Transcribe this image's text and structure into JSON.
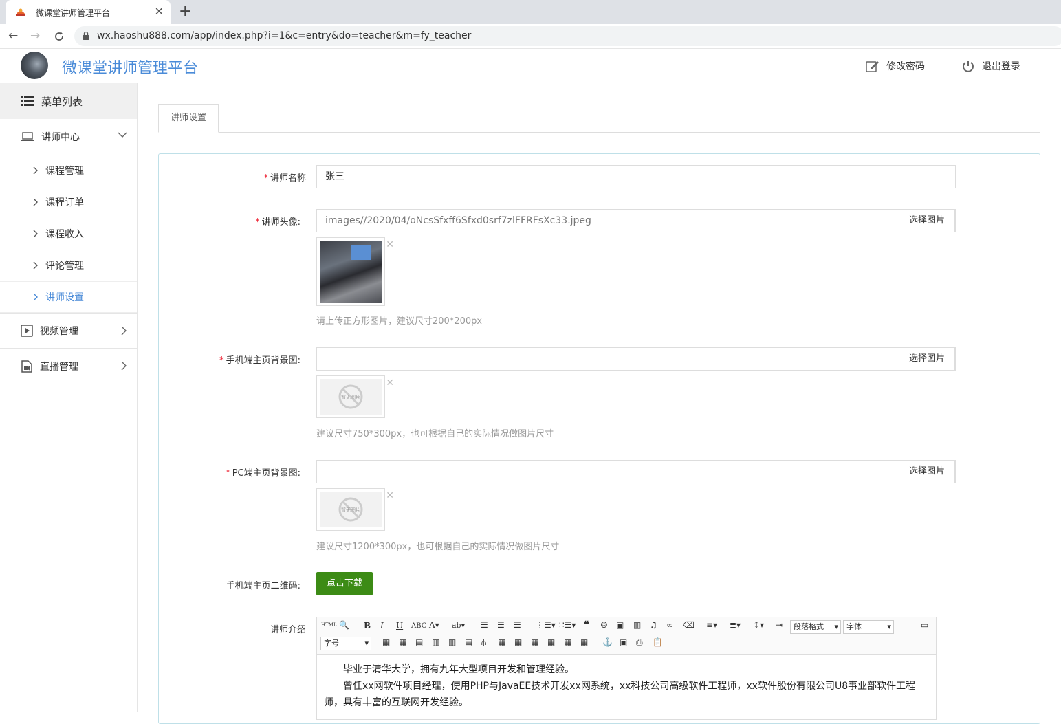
{
  "browser": {
    "tab_title": "微课堂讲师管理平台",
    "url": "wx.haoshu888.com/app/index.php?i=1&c=entry&do=teacher&m=fy_teacher"
  },
  "header": {
    "brand": "微课堂讲师管理平台",
    "change_password": "修改密码",
    "logout": "退出登录"
  },
  "sidebar": {
    "menu_title": "菜单列表",
    "groups": [
      {
        "label": "讲师中心",
        "items": [
          "课程管理",
          "课程订单",
          "课程收入",
          "评论管理",
          "讲师设置"
        ]
      },
      {
        "label": "视频管理"
      },
      {
        "label": "直播管理"
      }
    ]
  },
  "tabs": [
    "讲师设置"
  ],
  "form": {
    "name_label": "讲师名称",
    "name_value": "张三",
    "avatar_label": "讲师头像:",
    "avatar_value": "images//2020/04/oNcsSfxff6Sfxd0srf7zlFFRFsXc33.jpeg",
    "pick_label": "选择图片",
    "avatar_hint": "请上传正方形图片，建议尺寸200*200px",
    "mobile_bg_label": "手机端主页背景图:",
    "mobile_bg_hint": "建议尺寸750*300px，也可根据自己的实际情况做图片尺寸",
    "pc_bg_label": "PC端主页背景图:",
    "pc_bg_hint": "建议尺寸1200*300px，也可根据自己的实际情况做图片尺寸",
    "no_image": "暂无图片",
    "qrcode_label": "手机端主页二维码:",
    "download_label": "点击下载",
    "intro_label": "讲师介绍"
  },
  "editor": {
    "paragraph_select": "段落格式",
    "font_select": "字体",
    "size_select": "字号",
    "html_label": "HTML",
    "content": [
      "毕业于清华大学，拥有九年大型项目开发和管理经验。",
      "曾任xx网软件项目经理，使用PHP与JavaEE技术开发xx网系统，xx科技公司高级软件工程师，xx软件股份有限公司U8事业部软件工程师，具有丰富的互联网开发经验。"
    ]
  },
  "colors": {
    "accent": "#4a8bd8",
    "download_button": "#3c8b15",
    "required": "#e23"
  }
}
